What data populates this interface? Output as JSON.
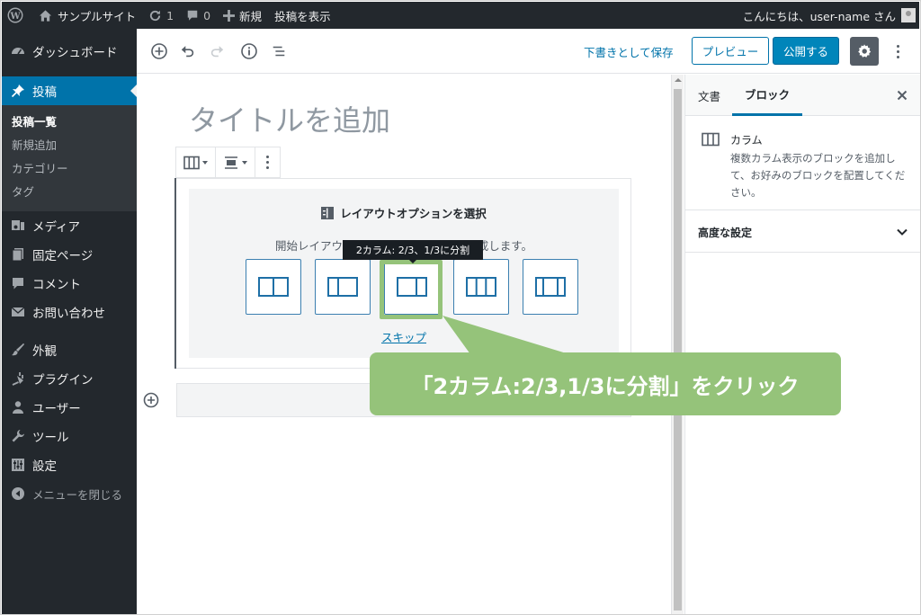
{
  "adminbar": {
    "site_name": "サンプルサイト",
    "updates_count": "1",
    "comments_count": "0",
    "new_label": "新規",
    "view_post_label": "投稿を表示",
    "greeting": "こんにちは、user-name さん"
  },
  "sidebar": {
    "items": [
      {
        "label": "ダッシュボード",
        "icon": "dashboard-icon"
      },
      {
        "label": "投稿",
        "icon": "pin-icon"
      },
      {
        "label": "メディア",
        "icon": "media-icon"
      },
      {
        "label": "固定ページ",
        "icon": "page-icon"
      },
      {
        "label": "コメント",
        "icon": "comment-icon"
      },
      {
        "label": "お問い合わせ",
        "icon": "mail-icon"
      },
      {
        "label": "外観",
        "icon": "brush-icon"
      },
      {
        "label": "プラグイン",
        "icon": "plugin-icon"
      },
      {
        "label": "ユーザー",
        "icon": "user-icon"
      },
      {
        "label": "ツール",
        "icon": "wrench-icon"
      },
      {
        "label": "設定",
        "icon": "settings-icon"
      },
      {
        "label": "メニューを閉じる",
        "icon": "collapse-icon"
      }
    ],
    "submenu": [
      "投稿一覧",
      "新規追加",
      "カテゴリー",
      "タグ"
    ]
  },
  "toolbar": {
    "save_draft": "下書きとして保存",
    "preview": "プレビュー",
    "publish": "公開する"
  },
  "editor": {
    "title_placeholder": "タイトルを追加",
    "placeholder_label": "レイアウトオプションを選択",
    "placeholder_instructions": "開始レイアウトを選択するか、独自に作成します。",
    "tooltip": "2カラム: 2/3、1/3に分割",
    "skip": "スキップ"
  },
  "callout": {
    "text": "「2カラム:2/3,1/3に分割」をクリック"
  },
  "panel": {
    "tab_document": "文書",
    "tab_block": "ブロック",
    "block_title": "カラム",
    "block_description": "複数カラム表示のブロックを追加して、お好みのブロックを配置してください。",
    "advanced": "高度な設定"
  },
  "colors": {
    "admin_dark": "#23282d",
    "accent_blue": "#0073aa",
    "callout_green": "#95c37a"
  }
}
